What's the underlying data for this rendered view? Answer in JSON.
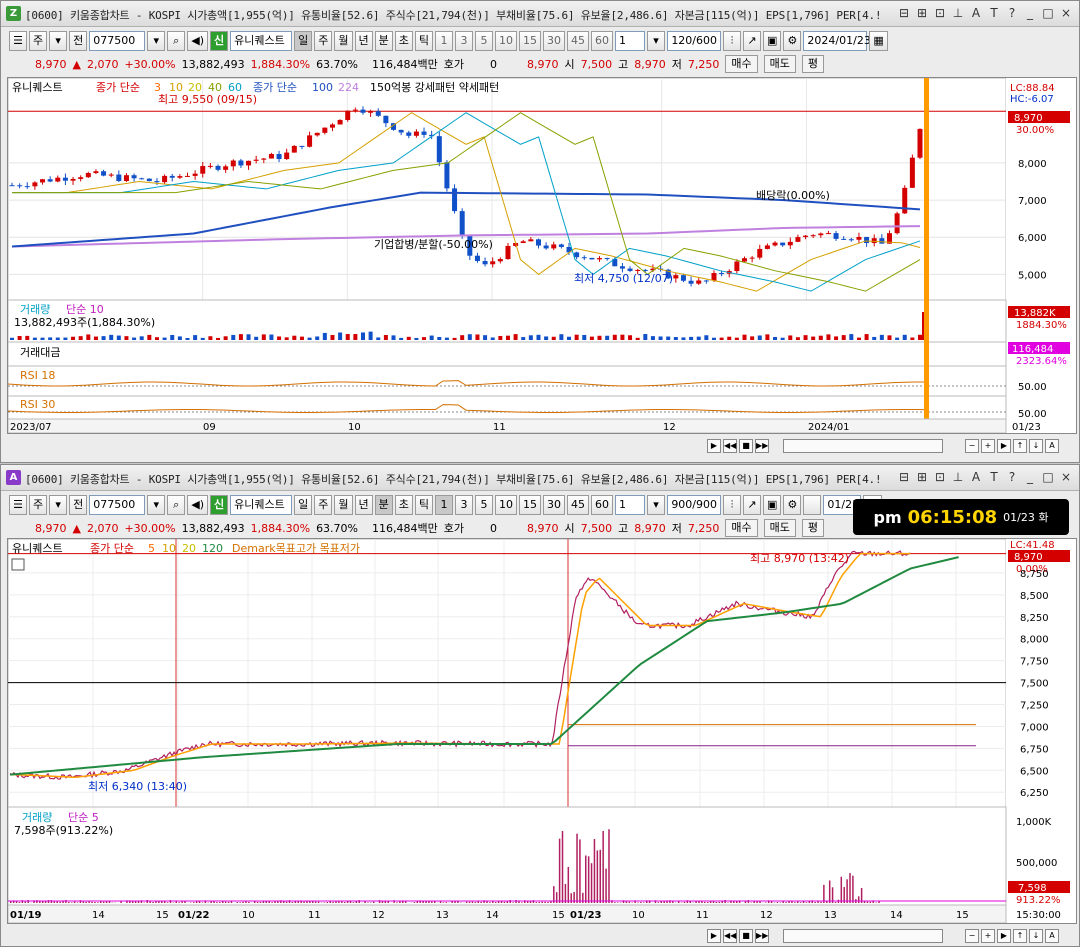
{
  "window1": {
    "badge": "Z",
    "title": "[0600] 키움종합차트 - KOSPI 시가총액[1,955(억)] 유통비율[52.6] 주식수[21,794(천)] 부채비율[75.6] 유보율[2,486.6] 자본금[115(억)] EPS[1,796] PER[4.!",
    "toolbar": {
      "mode": "주",
      "prev": "전",
      "code": "077500",
      "sin": "신",
      "name": "유니퀘스트",
      "periods": [
        "일",
        "주",
        "월",
        "년",
        "분",
        "초",
        "틱"
      ],
      "minutes": [
        "1",
        "3",
        "5",
        "10",
        "15",
        "30",
        "45",
        "60"
      ],
      "selected_n": "1",
      "count": "120/600",
      "date": "2024/01/23"
    },
    "quote": {
      "price": "8,970",
      "change": "2,070",
      "pct": "+30.00%",
      "volume": "13,882,493",
      "vol_pct": "1,884.30%",
      "ratio": "63.70%",
      "amount": "116,484백만",
      "hoga_label": "호가",
      "hoga": "0",
      "cur": "8,970",
      "open_label": "시",
      "open": "7,500",
      "high_label": "고",
      "high": "8,970",
      "low_label": "저",
      "low": "7,250",
      "buy": "매수",
      "sell": "매도",
      "flat": "평"
    },
    "legend": {
      "name": "유니퀘스트",
      "ma_label": "종가 단순",
      "ma_periods": [
        "3",
        "10",
        "20",
        "40",
        "60"
      ],
      "ma2_label": "종가 단순",
      "ma2_periods": [
        "100",
        "224"
      ],
      "extra": "150억봉 강세패턴  약세패턴"
    },
    "right_labels": {
      "lc": "LC:88.84",
      "hc": "HC:-6.07",
      "price": "8,970",
      "pct": "30.00%"
    },
    "annotations": {
      "high": "최고 9,550 (09/15)",
      "low": "최저 4,750 (12/07)",
      "dividend": "배당락(0.00%)",
      "split": "기업합병/분할(-50.00%)"
    },
    "volume_panel": {
      "label": "거래량",
      "ma": "단순 10",
      "value": "13,882,493주(1,884.30%)",
      "right_value": "13,882K",
      "right_pct": "1884.30%"
    },
    "amount_panel": {
      "label": "거래대금",
      "right_value": "116,484",
      "right_pct": "2323.64%"
    },
    "rsi1": {
      "label": "RSI 18",
      "level": "50.00"
    },
    "rsi2": {
      "label": "RSI 30",
      "level": "50.00"
    },
    "x_labels": [
      "2023/07",
      "09",
      "10",
      "11",
      "12",
      "2024/01",
      "01/23"
    ]
  },
  "window2": {
    "badge": "A",
    "title": "[0600] 키움종합차트 - KOSPI 시가총액[1,955(억)] 유통비율[52.6] 주식수[21,794(천)] 부채비율[75.6] 유보율[2,486.6] 자본금[115(억)] EPS[1,796] PER[4.!",
    "toolbar": {
      "mode": "주",
      "prev": "전",
      "code": "077500",
      "sin": "신",
      "name": "유니퀘스트",
      "periods": [
        "일",
        "주",
        "월",
        "년",
        "분",
        "초",
        "틱"
      ],
      "minutes": [
        "1",
        "3",
        "5",
        "10",
        "15",
        "30",
        "45",
        "60"
      ],
      "selected_n": "1",
      "count": "900/900",
      "date": "01/23"
    },
    "clock": {
      "ampm": "pm",
      "time": "06:15:08",
      "date": "01/23 화"
    },
    "quote": {
      "price": "8,970",
      "change": "2,070",
      "pct": "+30.00%",
      "volume": "13,882,493",
      "vol_pct": "1,884.30%",
      "ratio": "63.70%",
      "amount": "116,484백만",
      "hoga_label": "호가",
      "hoga": "0",
      "cur": "8,970",
      "open_label": "시",
      "open": "7,500",
      "high_label": "고",
      "high": "8,970",
      "low_label": "저",
      "low": "7,250",
      "buy": "매수",
      "sell": "매도",
      "flat": "평"
    },
    "legend": {
      "name": "유니퀘스트",
      "ma_label": "종가 단순",
      "ma_periods": [
        "5",
        "10",
        "20",
        "120"
      ],
      "extra": "Demark목표고가  목표저가"
    },
    "right_labels": {
      "lc": "LC:41.48",
      "price": "8,970",
      "pct": "0.00%"
    },
    "annotations": {
      "high": "최고 8,970 (13:42)",
      "low": "최저 6,340 (13:40)"
    },
    "volume_panel": {
      "label": "거래량",
      "ma": "단순 5",
      "value": "7,598주(913.22%)",
      "right_value": "7,598",
      "right_pct": "913.22%"
    },
    "x_labels": [
      "01/19",
      "14",
      "15",
      "01/22",
      "10",
      "11",
      "12",
      "13",
      "14",
      "15",
      "01/23",
      "10",
      "11",
      "12",
      "13",
      "14",
      "15",
      "15:30:00"
    ]
  },
  "chart_data": [
    {
      "type": "candlestick",
      "title": "유니퀘스트 일봉",
      "x": [
        "2023/07",
        "09",
        "10",
        "11",
        "12",
        "2024/01",
        "01/23"
      ],
      "y_ticks": [
        5000,
        6000,
        7000,
        8000
      ],
      "ylim": [
        4500,
        9800
      ],
      "series": [
        {
          "name": "종가",
          "points": [
            [
              0,
              7400
            ],
            [
              0.08,
              7700
            ],
            [
              0.16,
              7500
            ],
            [
              0.24,
              8000
            ],
            [
              0.3,
              8200
            ],
            [
              0.38,
              9550
            ],
            [
              0.44,
              8700
            ],
            [
              0.46,
              8900
            ],
            [
              0.5,
              5600
            ],
            [
              0.52,
              5200
            ],
            [
              0.56,
              5900
            ],
            [
              0.6,
              5700
            ],
            [
              0.66,
              5300
            ],
            [
              0.72,
              5000
            ],
            [
              0.76,
              4750
            ],
            [
              0.82,
              5600
            ],
            [
              0.88,
              6100
            ],
            [
              0.92,
              6050
            ],
            [
              0.96,
              5800
            ],
            [
              0.98,
              6900
            ],
            [
              1.0,
              8970
            ]
          ]
        },
        {
          "name": "단순 224",
          "points": [
            [
              0,
              5750
            ],
            [
              0.3,
              5950
            ],
            [
              0.5,
              6050
            ],
            [
              0.7,
              6100
            ],
            [
              0.85,
              6250
            ],
            [
              1.0,
              6300
            ]
          ]
        },
        {
          "name": "단순 100",
          "points": [
            [
              0,
              5750
            ],
            [
              0.2,
              6100
            ],
            [
              0.35,
              6800
            ],
            [
              0.45,
              7200
            ],
            [
              0.7,
              7150
            ],
            [
              0.85,
              7000
            ],
            [
              1.0,
              6750
            ]
          ]
        }
      ],
      "annotations": [
        "최고 9,550 (09/15)",
        "최저 4,750 (12/07)",
        "배당락(0.00%)",
        "기업합병/분할(-50.00%)"
      ]
    },
    {
      "type": "line",
      "title": "유니퀘스트 1분봉",
      "x": [
        "01/19",
        "01/22",
        "01/23",
        "15:30:00"
      ],
      "y_ticks": [
        6250,
        6500,
        6750,
        7000,
        7250,
        7500,
        7750,
        8000,
        8250,
        8500,
        8750
      ],
      "ylim": [
        6150,
        9000
      ],
      "series": [
        {
          "name": "종가",
          "points": [
            [
              0,
              6450
            ],
            [
              0.06,
              6420
            ],
            [
              0.12,
              6500
            ],
            [
              0.16,
              6660
            ],
            [
              0.2,
              6800
            ],
            [
              0.3,
              6800
            ],
            [
              0.4,
              6810
            ],
            [
              0.5,
              6800
            ],
            [
              0.56,
              6800
            ],
            [
              0.57,
              7500
            ],
            [
              0.585,
              8500
            ],
            [
              0.6,
              8700
            ],
            [
              0.65,
              8150
            ],
            [
              0.7,
              8150
            ],
            [
              0.75,
              8400
            ],
            [
              0.8,
              8300
            ],
            [
              0.83,
              8250
            ],
            [
              0.85,
              8700
            ],
            [
              0.87,
              8970
            ],
            [
              0.93,
              8970
            ]
          ]
        },
        {
          "name": "단순 120",
          "points": [
            [
              0,
              6450
            ],
            [
              0.2,
              6650
            ],
            [
              0.4,
              6800
            ],
            [
              0.56,
              6800
            ],
            [
              0.65,
              7700
            ],
            [
              0.72,
              8200
            ],
            [
              0.8,
              8300
            ],
            [
              0.86,
              8400
            ],
            [
              0.93,
              8800
            ],
            [
              0.98,
              8930
            ]
          ]
        }
      ],
      "reference_lines": [
        7500,
        7020,
        6780
      ],
      "annotations": [
        "최고 8,970 (13:42)",
        "최저 6,340 (13:40)"
      ]
    }
  ]
}
